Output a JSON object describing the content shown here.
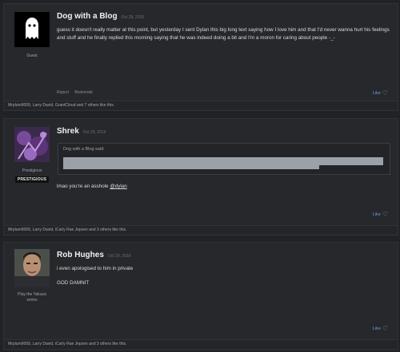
{
  "posts": [
    {
      "username": "Dog with a Blog",
      "date": "Oct 29, 2016",
      "user_title": "Guest",
      "body": "guess it doesn't really matter at this point, but yesterday I sent Dylan this big long text saying how I love him and that I'd never wanna hurt his feelings and stuff and he finally replied this morning saying that he was indeed doing a bit and I'm a moron for caring about people -_-",
      "actions": [
        "Report",
        "Bookmark"
      ],
      "like_label": "Like",
      "likes_text": "Mrplum9009, Larry David, GrantCloud and 7 others like this."
    },
    {
      "username": "Shrek",
      "date": "Oct 29, 2016",
      "user_title": "Prestigious",
      "badge": "PRESTIGIOUS",
      "quote_author": "Dog with a Blog said:",
      "body_prefix": "lmao you're an asshole ",
      "mention": "@dylan",
      "like_label": "Like",
      "likes_text": "Mrplum9009, Larry David, iCarly Rae Jepsen and 3 others like this."
    },
    {
      "username": "Rob Hughes",
      "date": "Oct 29, 2016",
      "user_title": "Play the Yakuza series",
      "body_line1": "i even apologised to him in private",
      "body_line2": "GOD DAMNIT",
      "like_label": "Like",
      "likes_text": "Mrplum9009, Larry David, iCarly Rae Jepsen and 3 others like this."
    }
  ],
  "icons": {
    "guest_avatar": "ghost-icon",
    "like": "heart-icon"
  },
  "colors": {
    "background": "#202225",
    "post_bg": "#26282c",
    "link": "#6ea0d6"
  }
}
